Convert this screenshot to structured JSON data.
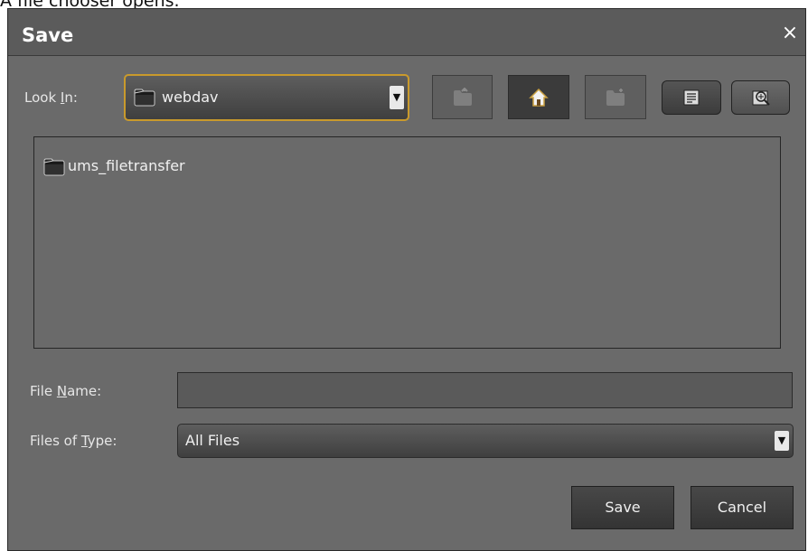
{
  "caption": "A file chooser opens.",
  "dialog": {
    "title": "Save",
    "close_glyph": "×"
  },
  "look_in": {
    "label_prefix": "Look ",
    "label_mnemonic": "I",
    "label_suffix": "n:",
    "value": "webdav"
  },
  "toolbar": {
    "buttons": [
      {
        "name": "up-one-level",
        "icon": "folder-up-icon",
        "enabled": false
      },
      {
        "name": "home",
        "icon": "home-icon",
        "enabled": true
      },
      {
        "name": "new-folder",
        "icon": "new-folder-icon",
        "enabled": false
      },
      {
        "name": "list-view",
        "icon": "list-view-icon",
        "enabled": true,
        "selected": true
      },
      {
        "name": "details-view",
        "icon": "details-view-icon",
        "enabled": true
      }
    ]
  },
  "file_list": {
    "items": [
      {
        "name": "ums_filetransfer",
        "icon": "folder-icon"
      }
    ]
  },
  "file_name": {
    "label_prefix": "File ",
    "label_mnemonic": "N",
    "label_suffix": "ame:",
    "value": ""
  },
  "files_of_type": {
    "label_prefix": "Files of ",
    "label_mnemonic": "T",
    "label_suffix": "ype:",
    "value": "All Files"
  },
  "buttons": {
    "save": "Save",
    "cancel": "Cancel"
  },
  "colors": {
    "dialog_bg": "#6a6a6a",
    "titlebar_bg": "#5b5b5b",
    "focus_border": "#c99a2c"
  }
}
